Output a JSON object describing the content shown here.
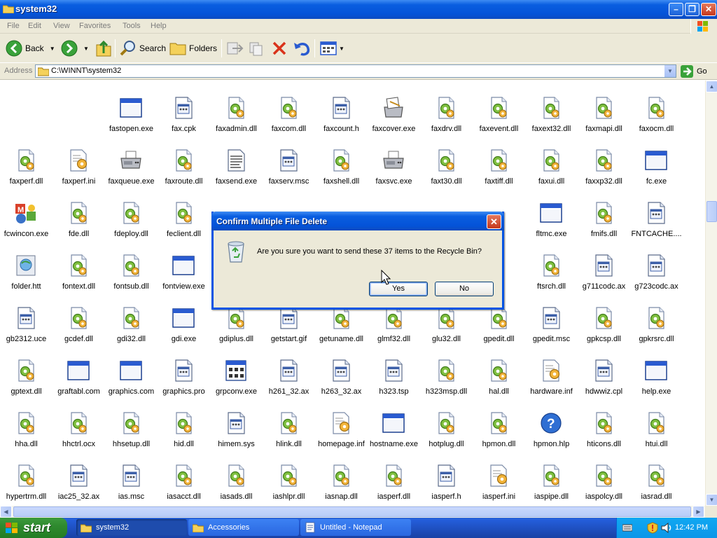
{
  "window": {
    "title": "system32"
  },
  "menu": [
    "File",
    "Edit",
    "View",
    "Favorites",
    "Tools",
    "Help"
  ],
  "toolbar": {
    "back_label": "Back",
    "search_label": "Search",
    "folders_label": "Folders"
  },
  "address": {
    "label": "Address",
    "path": "C:\\WINNT\\system32",
    "go_label": "Go"
  },
  "files": [
    {
      "name": "fastopen.exe",
      "icon": "window-exe-icon"
    },
    {
      "name": "fax.cpk",
      "icon": "system-file-icon"
    },
    {
      "name": "faxadmin.dll",
      "icon": "dll-gear-icon"
    },
    {
      "name": "faxcom.dll",
      "icon": "dll-gear-icon"
    },
    {
      "name": "faxcount.h",
      "icon": "system-file-icon"
    },
    {
      "name": "faxcover.exe",
      "icon": "fax-cover-icon"
    },
    {
      "name": "faxdrv.dll",
      "icon": "dll-gear-icon"
    },
    {
      "name": "faxevent.dll",
      "icon": "dll-gear-icon"
    },
    {
      "name": "faxext32.dll",
      "icon": "dll-gear-icon"
    },
    {
      "name": "faxmapi.dll",
      "icon": "dll-gear-icon"
    },
    {
      "name": "faxocm.dll",
      "icon": "dll-gear-icon"
    },
    {
      "name": "faxperf.dll",
      "icon": "dll-gear-icon"
    },
    {
      "name": "faxperf.ini",
      "icon": "ini-settings-icon"
    },
    {
      "name": "faxqueue.exe",
      "icon": "fax-machine-icon"
    },
    {
      "name": "faxroute.dll",
      "icon": "dll-gear-icon"
    },
    {
      "name": "faxsend.exe",
      "icon": "text-document-icon"
    },
    {
      "name": "faxserv.msc",
      "icon": "system-file-icon"
    },
    {
      "name": "faxshell.dll",
      "icon": "dll-gear-icon"
    },
    {
      "name": "faxsvc.exe",
      "icon": "fax-machine-icon"
    },
    {
      "name": "faxt30.dll",
      "icon": "dll-gear-icon"
    },
    {
      "name": "faxtiff.dll",
      "icon": "dll-gear-icon"
    },
    {
      "name": "faxui.dll",
      "icon": "dll-gear-icon"
    },
    {
      "name": "faxxp32.dll",
      "icon": "dll-gear-icon"
    },
    {
      "name": "fc.exe",
      "icon": "window-exe-icon"
    },
    {
      "name": "fcwincon.exe",
      "icon": "office-shapes-icon"
    },
    {
      "name": "fde.dll",
      "icon": "dll-gear-icon"
    },
    {
      "name": "fdeploy.dll",
      "icon": "dll-gear-icon"
    },
    {
      "name": "feclient.dll",
      "icon": "dll-gear-icon"
    },
    {
      "name": "",
      "icon": "hidden"
    },
    {
      "name": "",
      "icon": "hidden"
    },
    {
      "name": "",
      "icon": "hidden"
    },
    {
      "name": "",
      "icon": "hidden"
    },
    {
      "name": "",
      "icon": "hidden"
    },
    {
      "name": "dll",
      "icon": "hidden"
    },
    {
      "name": "fltmc.exe",
      "icon": "window-exe-icon"
    },
    {
      "name": "fmifs.dll",
      "icon": "dll-gear-icon"
    },
    {
      "name": "FNTCACHE....",
      "icon": "system-file-icon"
    },
    {
      "name": "folder.htt",
      "icon": "html-template-icon"
    },
    {
      "name": "fontext.dll",
      "icon": "dll-gear-icon"
    },
    {
      "name": "fontsub.dll",
      "icon": "dll-gear-icon"
    },
    {
      "name": "fontview.exe",
      "icon": "window-exe-icon"
    },
    {
      "name": "",
      "icon": "hidden"
    },
    {
      "name": "",
      "icon": "hidden"
    },
    {
      "name": "",
      "icon": "hidden"
    },
    {
      "name": "",
      "icon": "hidden"
    },
    {
      "name": "",
      "icon": "hidden"
    },
    {
      "name": "ke",
      "icon": "hidden"
    },
    {
      "name": "ftsrch.dll",
      "icon": "dll-gear-icon"
    },
    {
      "name": "g711codc.ax",
      "icon": "system-file-icon"
    },
    {
      "name": "g723codc.ax",
      "icon": "system-file-icon"
    },
    {
      "name": "gb2312.uce",
      "icon": "system-file-icon"
    },
    {
      "name": "gcdef.dll",
      "icon": "dll-gear-icon"
    },
    {
      "name": "gdi32.dll",
      "icon": "dll-gear-icon"
    },
    {
      "name": "gdi.exe",
      "icon": "window-exe-icon"
    },
    {
      "name": "gdiplus.dll",
      "icon": "dll-gear-icon"
    },
    {
      "name": "getstart.gif",
      "icon": "system-file-icon"
    },
    {
      "name": "getuname.dll",
      "icon": "dll-gear-icon"
    },
    {
      "name": "glmf32.dll",
      "icon": "dll-gear-icon"
    },
    {
      "name": "glu32.dll",
      "icon": "dll-gear-icon"
    },
    {
      "name": "gpedit.dll",
      "icon": "dll-gear-icon"
    },
    {
      "name": "gpedit.msc",
      "icon": "system-file-icon"
    },
    {
      "name": "gpkcsp.dll",
      "icon": "dll-gear-icon"
    },
    {
      "name": "gpkrsrc.dll",
      "icon": "dll-gear-icon"
    },
    {
      "name": "gptext.dll",
      "icon": "dll-gear-icon"
    },
    {
      "name": "graftabl.com",
      "icon": "window-exe-icon"
    },
    {
      "name": "graphics.com",
      "icon": "window-exe-icon"
    },
    {
      "name": "graphics.pro",
      "icon": "system-file-icon"
    },
    {
      "name": "grpconv.exe",
      "icon": "program-group-icon"
    },
    {
      "name": "h261_32.ax",
      "icon": "system-file-icon"
    },
    {
      "name": "h263_32.ax",
      "icon": "system-file-icon"
    },
    {
      "name": "h323.tsp",
      "icon": "system-file-icon"
    },
    {
      "name": "h323msp.dll",
      "icon": "dll-gear-icon"
    },
    {
      "name": "hal.dll",
      "icon": "dll-gear-icon"
    },
    {
      "name": "hardware.inf",
      "icon": "ini-settings-icon"
    },
    {
      "name": "hdwwiz.cpl",
      "icon": "system-file-icon"
    },
    {
      "name": "help.exe",
      "icon": "window-exe-icon"
    },
    {
      "name": "hha.dll",
      "icon": "dll-gear-icon"
    },
    {
      "name": "hhctrl.ocx",
      "icon": "dll-gear-icon"
    },
    {
      "name": "hhsetup.dll",
      "icon": "dll-gear-icon"
    },
    {
      "name": "hid.dll",
      "icon": "dll-gear-icon"
    },
    {
      "name": "himem.sys",
      "icon": "system-file-icon"
    },
    {
      "name": "hlink.dll",
      "icon": "dll-gear-icon"
    },
    {
      "name": "homepage.inf",
      "icon": "ini-settings-icon"
    },
    {
      "name": "hostname.exe",
      "icon": "window-exe-icon"
    },
    {
      "name": "hotplug.dll",
      "icon": "dll-gear-icon"
    },
    {
      "name": "hpmon.dll",
      "icon": "dll-gear-icon"
    },
    {
      "name": "hpmon.hlp",
      "icon": "help-icon"
    },
    {
      "name": "hticons.dll",
      "icon": "dll-gear-icon"
    },
    {
      "name": "htui.dll",
      "icon": "dll-gear-icon"
    },
    {
      "name": "hypertrm.dll",
      "icon": "dll-gear-icon"
    },
    {
      "name": "iac25_32.ax",
      "icon": "system-file-icon"
    },
    {
      "name": "ias.msc",
      "icon": "system-file-icon"
    },
    {
      "name": "iasacct.dll",
      "icon": "dll-gear-icon"
    },
    {
      "name": "iasads.dll",
      "icon": "dll-gear-icon"
    },
    {
      "name": "iashlpr.dll",
      "icon": "dll-gear-icon"
    },
    {
      "name": "iasnap.dll",
      "icon": "dll-gear-icon"
    },
    {
      "name": "iasperf.dll",
      "icon": "dll-gear-icon"
    },
    {
      "name": "iasperf.h",
      "icon": "system-file-icon"
    },
    {
      "name": "iasperf.ini",
      "icon": "ini-settings-icon"
    },
    {
      "name": "iaspipe.dll",
      "icon": "dll-gear-icon"
    },
    {
      "name": "iaspolcy.dll",
      "icon": "dll-gear-icon"
    },
    {
      "name": "iasrad.dll",
      "icon": "dll-gear-icon"
    }
  ],
  "dialog": {
    "title": "Confirm Multiple File Delete",
    "message": "Are you sure you want to send these 37 items to the Recycle Bin?",
    "yes_label": "Yes",
    "no_label": "No"
  },
  "taskbar": {
    "start_label": "start",
    "tasks": [
      {
        "label": "system32",
        "icon": "folder-icon",
        "active": true
      },
      {
        "label": "Accessories",
        "icon": "folder-icon",
        "active": false
      },
      {
        "label": "Untitled - Notepad",
        "icon": "notepad-icon",
        "active": false
      }
    ],
    "clock": "12:42 PM"
  },
  "colors": {
    "xp_blue": "#0054e3",
    "taskbar_green": "#2f8a2f",
    "tray_blue": "#0c96e8"
  }
}
